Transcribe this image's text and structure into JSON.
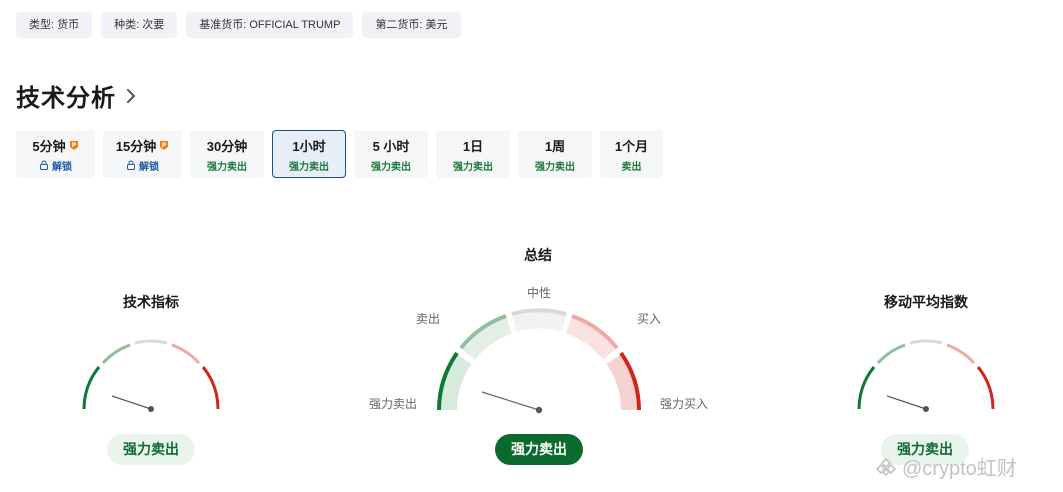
{
  "tags": [
    {
      "text": "类型: 货币"
    },
    {
      "text": "种类: 次要"
    },
    {
      "text": "基准货币: OFFICIAL TRUMP"
    },
    {
      "text": "第二货币: 美元"
    }
  ],
  "heading": {
    "title": "技术分析"
  },
  "timeframes": [
    {
      "label": "5分钟",
      "sub": "解锁",
      "locked": true
    },
    {
      "label": "15分钟",
      "sub": "解锁",
      "locked": true
    },
    {
      "label": "30分钟",
      "sub": "强力卖出"
    },
    {
      "label": "1小时",
      "sub": "强力卖出",
      "selected": true
    },
    {
      "label": "5 小时",
      "sub": "强力卖出"
    },
    {
      "label": "1日",
      "sub": "强力卖出"
    },
    {
      "label": "1周",
      "sub": "强力卖出"
    },
    {
      "label": "1个月",
      "sub": "卖出"
    }
  ],
  "gauges": {
    "technical": {
      "title": "技术指标",
      "result": "强力卖出"
    },
    "summary": {
      "title": "总结",
      "result": "强力卖出",
      "zones": {
        "strong_sell": "强力卖出",
        "sell": "卖出",
        "neutral": "中性",
        "buy": "买入",
        "strong_buy": "强力买入"
      }
    },
    "moving_avg": {
      "title": "移动平均指数",
      "result": "强力卖出"
    }
  },
  "colors": {
    "strong_sell": "#0b7a35",
    "sell": "#8fbf9c",
    "neutral": "#d9d9d9",
    "buy": "#efa8a3",
    "strong_buy": "#d0251b",
    "selected_border": "#1e4f8a"
  },
  "watermark": {
    "text": "@crypto虹财"
  }
}
